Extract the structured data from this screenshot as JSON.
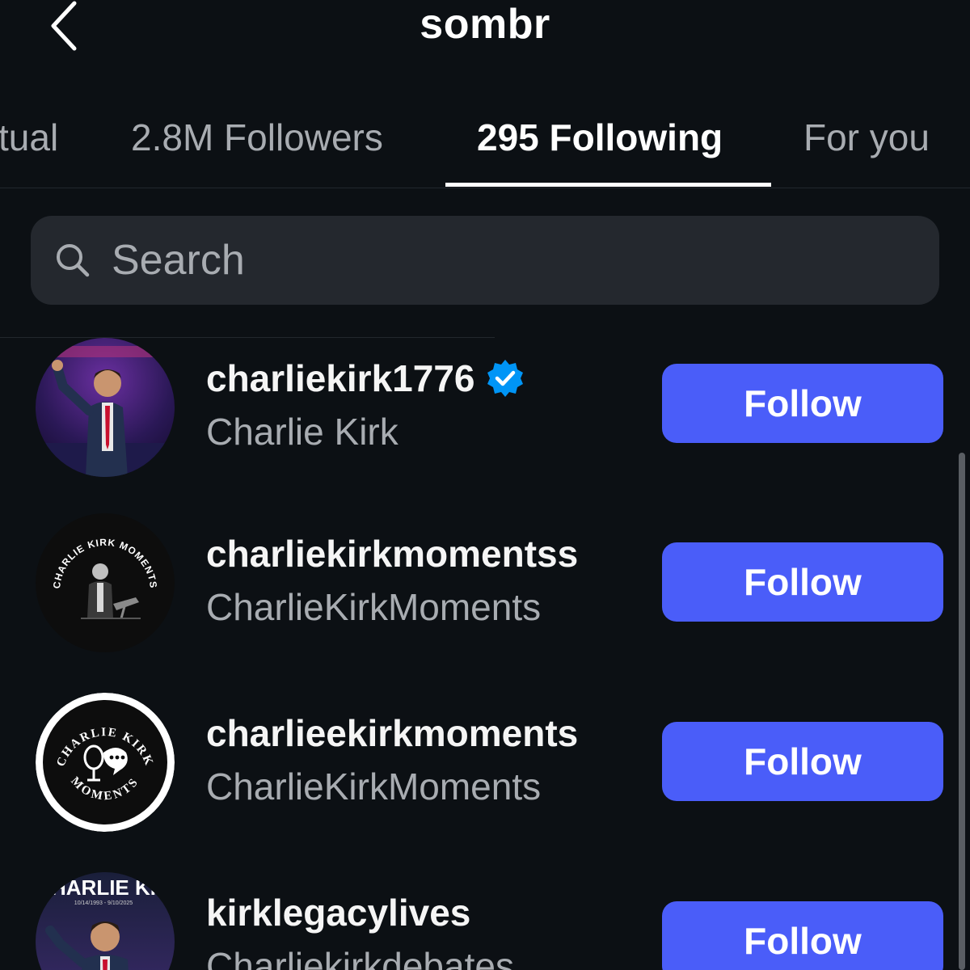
{
  "header": {
    "title": "sombr",
    "back_icon": "chevron-left-icon"
  },
  "tabs": [
    {
      "label": "Mutual",
      "visible_label": "tual"
    },
    {
      "label": "2.8M Followers"
    },
    {
      "label": "295 Following",
      "active": true
    },
    {
      "label": "For you"
    }
  ],
  "search": {
    "placeholder": "Search",
    "value": "",
    "icon": "search-icon"
  },
  "list": [
    {
      "username": "charliekirk1776",
      "fullname": "Charlie Kirk",
      "verified": true,
      "button": "Follow"
    },
    {
      "username": "charliekirkmomentss",
      "fullname": "CharlieKirkMoments",
      "verified": false,
      "avatar_text": "CHARLIE KIRK MOMENTS",
      "button": "Follow"
    },
    {
      "username": "charlieekirkmoments",
      "fullname": "CharlieKirkMoments",
      "verified": false,
      "avatar_text_top": "CHARLIE KIRK",
      "avatar_text_bottom": "MOMENTS",
      "button": "Follow"
    },
    {
      "username": "kirklegacylives",
      "fullname": "Charliekirkdebates",
      "verified": false,
      "avatar_text": "CHARLIE KIR",
      "avatar_subtext": "10/14/1993 - 9/10/2025",
      "button": "Follow"
    }
  ],
  "colors": {
    "background": "#0c1014",
    "follow_button": "#4a5df9",
    "verified_badge": "#0095f6",
    "secondary_text": "#a8acb1",
    "search_bg": "#24282e"
  }
}
